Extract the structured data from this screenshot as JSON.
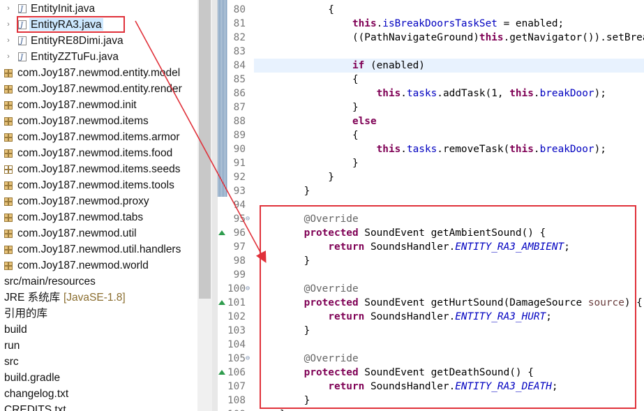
{
  "explorer": {
    "items": [
      {
        "label": "EntityInit.java",
        "type": "java",
        "expandable": true
      },
      {
        "label": "EntityRA3.java",
        "type": "java",
        "expandable": true,
        "selected": true
      },
      {
        "label": "EntityRE8Dimi.java",
        "type": "java",
        "expandable": true
      },
      {
        "label": "EntityZZTuFu.java",
        "type": "java",
        "expandable": true
      },
      {
        "label": "com.Joy187.newmod.entity.model",
        "type": "package"
      },
      {
        "label": "com.Joy187.newmod.entity.render",
        "type": "package"
      },
      {
        "label": "com.Joy187.newmod.init",
        "type": "package"
      },
      {
        "label": "com.Joy187.newmod.items",
        "type": "package"
      },
      {
        "label": "com.Joy187.newmod.items.armor",
        "type": "package"
      },
      {
        "label": "com.Joy187.newmod.items.food",
        "type": "package"
      },
      {
        "label": "com.Joy187.newmod.items.seeds",
        "type": "package-empty"
      },
      {
        "label": "com.Joy187.newmod.items.tools",
        "type": "package"
      },
      {
        "label": "com.Joy187.newmod.proxy",
        "type": "package"
      },
      {
        "label": "com.Joy187.newmod.tabs",
        "type": "package"
      },
      {
        "label": "com.Joy187.newmod.util",
        "type": "package"
      },
      {
        "label": "com.Joy187.newmod.util.handlers",
        "type": "package"
      },
      {
        "label": "com.Joy187.newmod.world",
        "type": "package"
      },
      {
        "label": "src/main/resources",
        "type": "folder"
      },
      {
        "label": "JRE 系统库",
        "decoration": "[JavaSE-1.8]",
        "type": "library"
      },
      {
        "label": "引用的库",
        "type": "library"
      },
      {
        "label": "build",
        "type": "folder"
      },
      {
        "label": "run",
        "type": "folder"
      },
      {
        "label": "src",
        "type": "folder"
      },
      {
        "label": "build.gradle",
        "type": "file"
      },
      {
        "label": "changelog.txt",
        "type": "file"
      },
      {
        "label": "CREDITS.txt",
        "type": "file"
      }
    ]
  },
  "editor": {
    "lines": [
      {
        "n": "80",
        "code": [
          [
            "",
            "        {"
          ]
        ]
      },
      {
        "n": "81",
        "code": [
          [
            "",
            "            "
          ],
          [
            "kw",
            "this"
          ],
          [
            "",
            "."
          ],
          [
            "fld",
            "isBreakDoorsTaskSet"
          ],
          [
            "",
            " = enabled;"
          ]
        ]
      },
      {
        "n": "82",
        "code": [
          [
            "",
            "            ((PathNavigateGround)"
          ],
          [
            "kw",
            "this"
          ],
          [
            "",
            ".getNavigator()).setBreakDoors(enabled);"
          ]
        ]
      },
      {
        "n": "83",
        "code": [
          [
            "",
            ""
          ]
        ]
      },
      {
        "n": "84",
        "code": [
          [
            "",
            "            "
          ],
          [
            "kw",
            "if"
          ],
          [
            "",
            " (enabled)"
          ]
        ],
        "current": true
      },
      {
        "n": "85",
        "code": [
          [
            "",
            "            {"
          ]
        ]
      },
      {
        "n": "86",
        "code": [
          [
            "",
            "                "
          ],
          [
            "kw",
            "this"
          ],
          [
            "",
            "."
          ],
          [
            "fld",
            "tasks"
          ],
          [
            "",
            ".addTask(1, "
          ],
          [
            "kw",
            "this"
          ],
          [
            "",
            "."
          ],
          [
            "fld",
            "breakDoor"
          ],
          [
            "",
            ");"
          ]
        ]
      },
      {
        "n": "87",
        "code": [
          [
            "",
            "            }"
          ]
        ]
      },
      {
        "n": "88",
        "code": [
          [
            "",
            "            "
          ],
          [
            "kw",
            "else"
          ]
        ]
      },
      {
        "n": "89",
        "code": [
          [
            "",
            "            {"
          ]
        ]
      },
      {
        "n": "90",
        "code": [
          [
            "",
            "                "
          ],
          [
            "kw",
            "this"
          ],
          [
            "",
            "."
          ],
          [
            "fld",
            "tasks"
          ],
          [
            "",
            ".removeTask("
          ],
          [
            "kw",
            "this"
          ],
          [
            "",
            "."
          ],
          [
            "fld",
            "breakDoor"
          ],
          [
            "",
            ");"
          ]
        ]
      },
      {
        "n": "91",
        "code": [
          [
            "",
            "            }"
          ]
        ]
      },
      {
        "n": "92",
        "code": [
          [
            "",
            "        }"
          ]
        ]
      },
      {
        "n": "93",
        "code": [
          [
            "",
            "    }"
          ]
        ]
      },
      {
        "n": "94",
        "code": [
          [
            "",
            ""
          ]
        ]
      },
      {
        "n": "95",
        "fold": true,
        "code": [
          [
            "",
            "    "
          ],
          [
            "ann",
            "@Override"
          ]
        ]
      },
      {
        "n": "96",
        "override": true,
        "code": [
          [
            "",
            "    "
          ],
          [
            "kw",
            "protected"
          ],
          [
            "",
            " SoundEvent getAmbientSound() {"
          ]
        ]
      },
      {
        "n": "97",
        "code": [
          [
            "",
            "        "
          ],
          [
            "kw",
            "return"
          ],
          [
            "",
            " SoundsHandler."
          ],
          [
            "sfld",
            "ENTITY_RA3_AMBIENT"
          ],
          [
            "",
            ";"
          ]
        ]
      },
      {
        "n": "98",
        "code": [
          [
            "",
            "    }"
          ]
        ]
      },
      {
        "n": "99",
        "code": [
          [
            "",
            ""
          ]
        ]
      },
      {
        "n": "100",
        "fold": true,
        "code": [
          [
            "",
            "    "
          ],
          [
            "ann",
            "@Override"
          ]
        ]
      },
      {
        "n": "101",
        "override": true,
        "code": [
          [
            "",
            "    "
          ],
          [
            "kw",
            "protected"
          ],
          [
            "",
            " SoundEvent getHurtSound(DamageSource "
          ],
          [
            "param",
            "source"
          ],
          [
            "",
            ") {"
          ]
        ]
      },
      {
        "n": "102",
        "code": [
          [
            "",
            "        "
          ],
          [
            "kw",
            "return"
          ],
          [
            "",
            " SoundsHandler."
          ],
          [
            "sfld",
            "ENTITY_RA3_HURT"
          ],
          [
            "",
            ";"
          ]
        ]
      },
      {
        "n": "103",
        "code": [
          [
            "",
            "    }"
          ]
        ]
      },
      {
        "n": "104",
        "code": [
          [
            "",
            ""
          ]
        ]
      },
      {
        "n": "105",
        "fold": true,
        "code": [
          [
            "",
            "    "
          ],
          [
            "ann",
            "@Override"
          ]
        ]
      },
      {
        "n": "106",
        "override": true,
        "code": [
          [
            "",
            "    "
          ],
          [
            "kw",
            "protected"
          ],
          [
            "",
            " SoundEvent getDeathSound() {"
          ]
        ]
      },
      {
        "n": "107",
        "code": [
          [
            "",
            "        "
          ],
          [
            "kw",
            "return"
          ],
          [
            "",
            " SoundsHandler."
          ],
          [
            "sfld",
            "ENTITY_RA3_DEATH"
          ],
          [
            "",
            ";"
          ]
        ]
      },
      {
        "n": "108",
        "code": [
          [
            "",
            "    }"
          ]
        ]
      },
      {
        "n": "109",
        "code": [
          [
            "",
            "}"
          ]
        ]
      }
    ]
  },
  "colors": {
    "annotation_red": "#e0313a",
    "keyword": "#7f0055",
    "field": "#0000c0",
    "selection": "#cde8ff"
  }
}
